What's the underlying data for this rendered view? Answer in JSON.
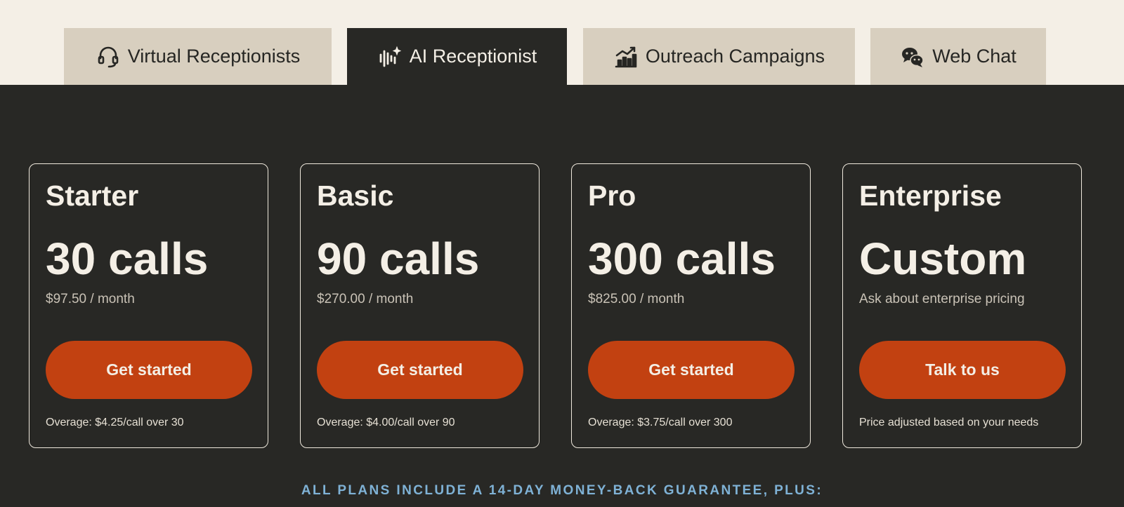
{
  "tabs": [
    {
      "label": "Virtual Receptionists",
      "icon": "headset-icon",
      "active": false
    },
    {
      "label": "AI Receptionist",
      "icon": "ai-waveform-icon",
      "active": true
    },
    {
      "label": "Outreach Campaigns",
      "icon": "growth-chart-icon",
      "active": false
    },
    {
      "label": "Web Chat",
      "icon": "chat-bubbles-icon",
      "active": false
    }
  ],
  "plans": [
    {
      "name": "Starter",
      "calls": "30 calls",
      "price": "$97.50 / month",
      "cta": "Get started",
      "note": "Overage: $4.25/call over 30"
    },
    {
      "name": "Basic",
      "calls": "90 calls",
      "price": "$270.00 / month",
      "cta": "Get started",
      "note": "Overage: $4.00/call over 90"
    },
    {
      "name": "Pro",
      "calls": "300 calls",
      "price": "$825.00 / month",
      "cta": "Get started",
      "note": "Overage: $3.75/call over 300"
    },
    {
      "name": "Enterprise",
      "calls": "Custom",
      "price": "Ask about enterprise pricing",
      "cta": "Talk to us",
      "note": "Price adjusted based on your needs"
    }
  ],
  "guarantee": "ALL PLANS INCLUDE A 14-DAY MONEY-BACK GUARANTEE, PLUS:",
  "colors": {
    "page_background": "#282825",
    "top_background": "#f4efe6",
    "tab_background": "#d8cfbf",
    "accent": "#c24111",
    "guarantee_text": "#7fb2d6"
  }
}
